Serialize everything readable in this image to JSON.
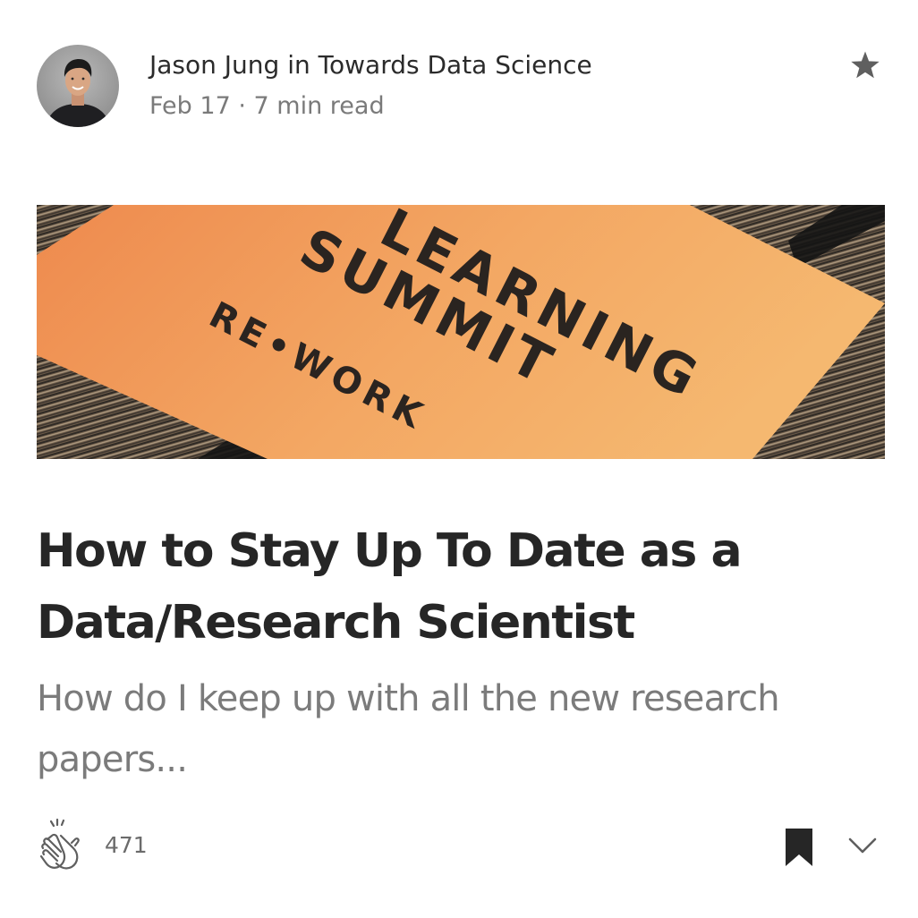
{
  "author": {
    "name": "Jason Jung",
    "connector": "in",
    "publication": "Towards Data Science"
  },
  "meta": {
    "date": "Feb 17",
    "separator": "·",
    "read_time": "7 min read"
  },
  "icons": {
    "member_only": "star-icon",
    "clap": "clap-icon",
    "bookmark": "bookmark-icon",
    "more": "chevron-down-icon"
  },
  "hero_image": {
    "line1": "LEARNING",
    "line2": "SUMMIT",
    "line3": "RE•WORK"
  },
  "article": {
    "title": "How to Stay Up To Date as a Data/Research Scientist",
    "subtitle": "How do I keep up with all the new research papers..."
  },
  "claps": {
    "count": "471"
  },
  "colors": {
    "text_primary": "#262626",
    "text_secondary": "#7b7b7b",
    "icon": "#5f5f5f",
    "hero_orange": "#f2a15c"
  }
}
